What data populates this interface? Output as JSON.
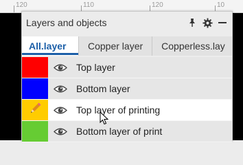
{
  "ruler": {
    "labels": [
      "120",
      "110",
      "120",
      "10"
    ]
  },
  "panel": {
    "title": "Layers and objects",
    "tools": [
      {
        "name": "pin-icon"
      },
      {
        "name": "gear-icon"
      },
      {
        "name": "minimize-icon"
      }
    ],
    "tabs": [
      {
        "label": "All.layer",
        "active": true
      },
      {
        "label": "Copper layer",
        "active": false
      },
      {
        "label": "Copperless.lay",
        "active": false
      }
    ],
    "layers": [
      {
        "label": "Top layer",
        "color": "#ff0000",
        "visible": true,
        "selected": false,
        "editing": false
      },
      {
        "label": "Bottom layer",
        "color": "#0000ff",
        "visible": true,
        "selected": false,
        "editing": false
      },
      {
        "label": "Top layer of printing",
        "color": "#ffcc00",
        "visible": true,
        "selected": true,
        "editing": true
      },
      {
        "label": "Bottom layer of print",
        "color": "#66cc33",
        "visible": true,
        "selected": false,
        "editing": false
      }
    ]
  }
}
